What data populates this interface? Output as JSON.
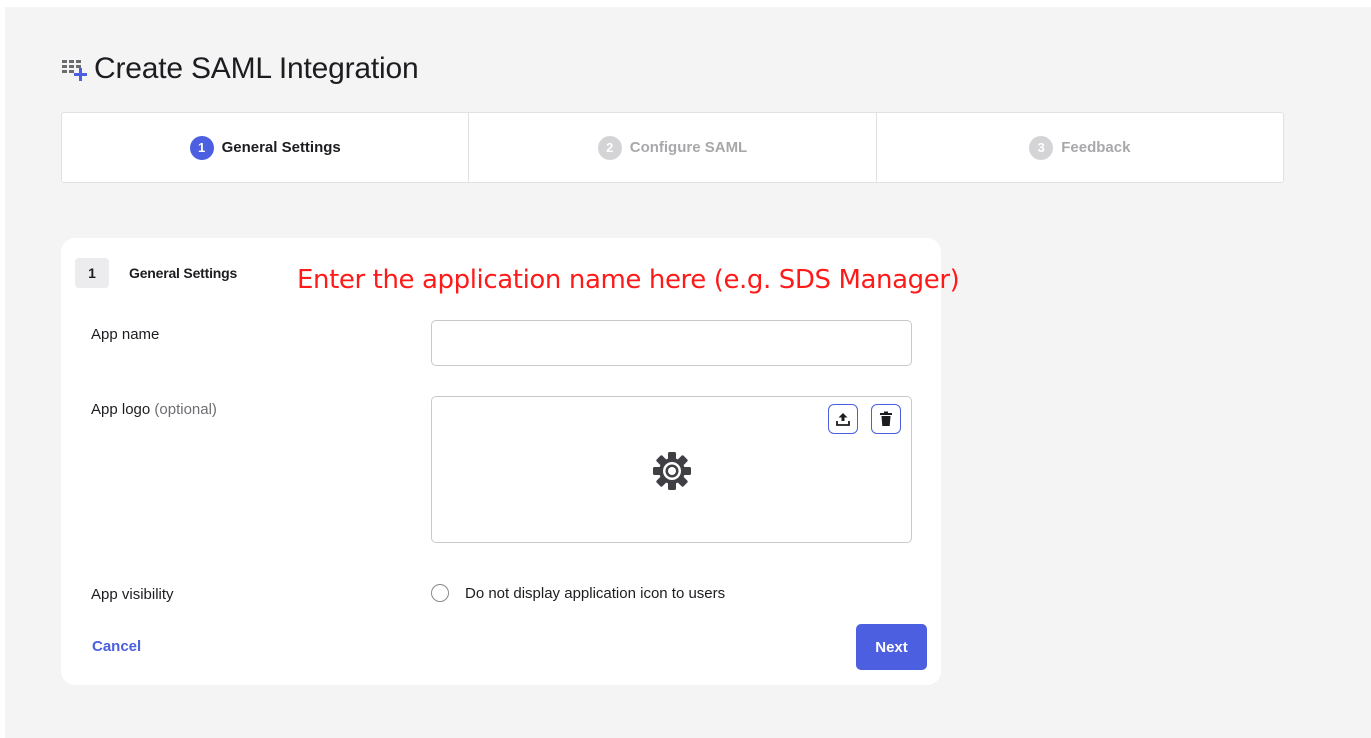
{
  "page": {
    "title": "Create SAML Integration"
  },
  "stepper": {
    "steps": [
      {
        "number": "1",
        "label": "General Settings",
        "state": "active"
      },
      {
        "number": "2",
        "label": "Configure SAML",
        "state": "inactive"
      },
      {
        "number": "3",
        "label": "Feedback",
        "state": "inactive"
      }
    ]
  },
  "form": {
    "section_number": "1",
    "section_title": "General Settings",
    "app_name_label": "App name",
    "app_name_value": "",
    "app_logo_label": "App logo",
    "app_logo_optional": "(optional)",
    "app_visibility_label": "App visibility",
    "visibility_checkbox_label": "Do not display application icon to users",
    "visibility_checked": false
  },
  "actions": {
    "cancel_label": "Cancel",
    "next_label": "Next"
  },
  "annotation": {
    "text": "Enter the application name here (e.g. SDS Manager)"
  },
  "icons": {
    "title": "grid-add-icon",
    "upload": "upload-icon",
    "delete": "trash-icon",
    "placeholder": "gear-icon"
  },
  "colors": {
    "accent": "#4b5fe0",
    "annotation": "#ff1a1a",
    "background": "#f4f4f4"
  }
}
